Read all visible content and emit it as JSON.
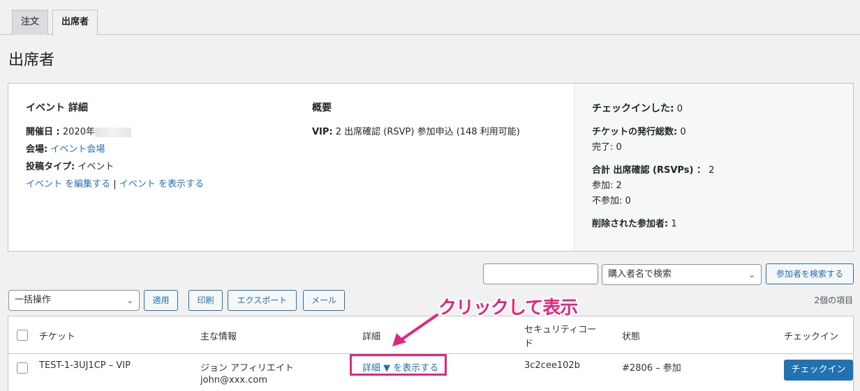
{
  "tabs": [
    {
      "label": "注文"
    },
    {
      "label": "出席者"
    }
  ],
  "page_title": "出席者",
  "event": {
    "details_title": "イベント 詳細",
    "date_label": "開催日 :",
    "date_value": "2020年",
    "venue_label": "会場:",
    "venue_value": "イベント会場",
    "post_type_label": "投稿タイプ:",
    "post_type_value": "イベント",
    "edit_link": "イベント を編集する",
    "separator": "|",
    "view_link": "イベント を表示する"
  },
  "overview": {
    "title": "概要",
    "line_label": "VIP:",
    "line_value": "2 出席確認 (RSVP) 参加申込 (148 利用可能)"
  },
  "stats": {
    "checked_in_label": "チェックインした:",
    "checked_in_value": "0",
    "issued_label": "チケットの発行総数:",
    "issued_value": "0",
    "completed": "完了: 0",
    "rsvp_total_label": "合計 出席確認 (RSVPs) ：",
    "rsvp_total_value": "2",
    "going": "参加: 2",
    "not_going": "不参加: 0",
    "deleted_label": "削除された参加者:",
    "deleted_value": "1"
  },
  "search": {
    "input_value": "",
    "select_value": "購入者名で検索",
    "button": "参加者を検索する"
  },
  "bulk": {
    "select_value": "一括操作",
    "apply": "適用",
    "print": "印刷",
    "export": "エクスポート",
    "email": "メール"
  },
  "item_count": "2個の項目",
  "table": {
    "columns": [
      "チケット",
      "主な情報",
      "詳細",
      "セキュリティコー",
      "ド",
      "状態",
      "チェックイン"
    ],
    "rows": [
      {
        "ticket": "TEST-1-3UJ1CP – VIP",
        "name": "ジョン アフィリエイト",
        "email": "john@xxx.com",
        "details_link": "詳細 ▼ を表示する",
        "security_code": "3c2cee102b",
        "status": "#2806 – 参加",
        "checkin_button": "チェックイン"
      }
    ]
  },
  "annotation": "クリックして表示",
  "colors": {
    "accent": "#2271b1",
    "annotation": "#e6247d"
  }
}
